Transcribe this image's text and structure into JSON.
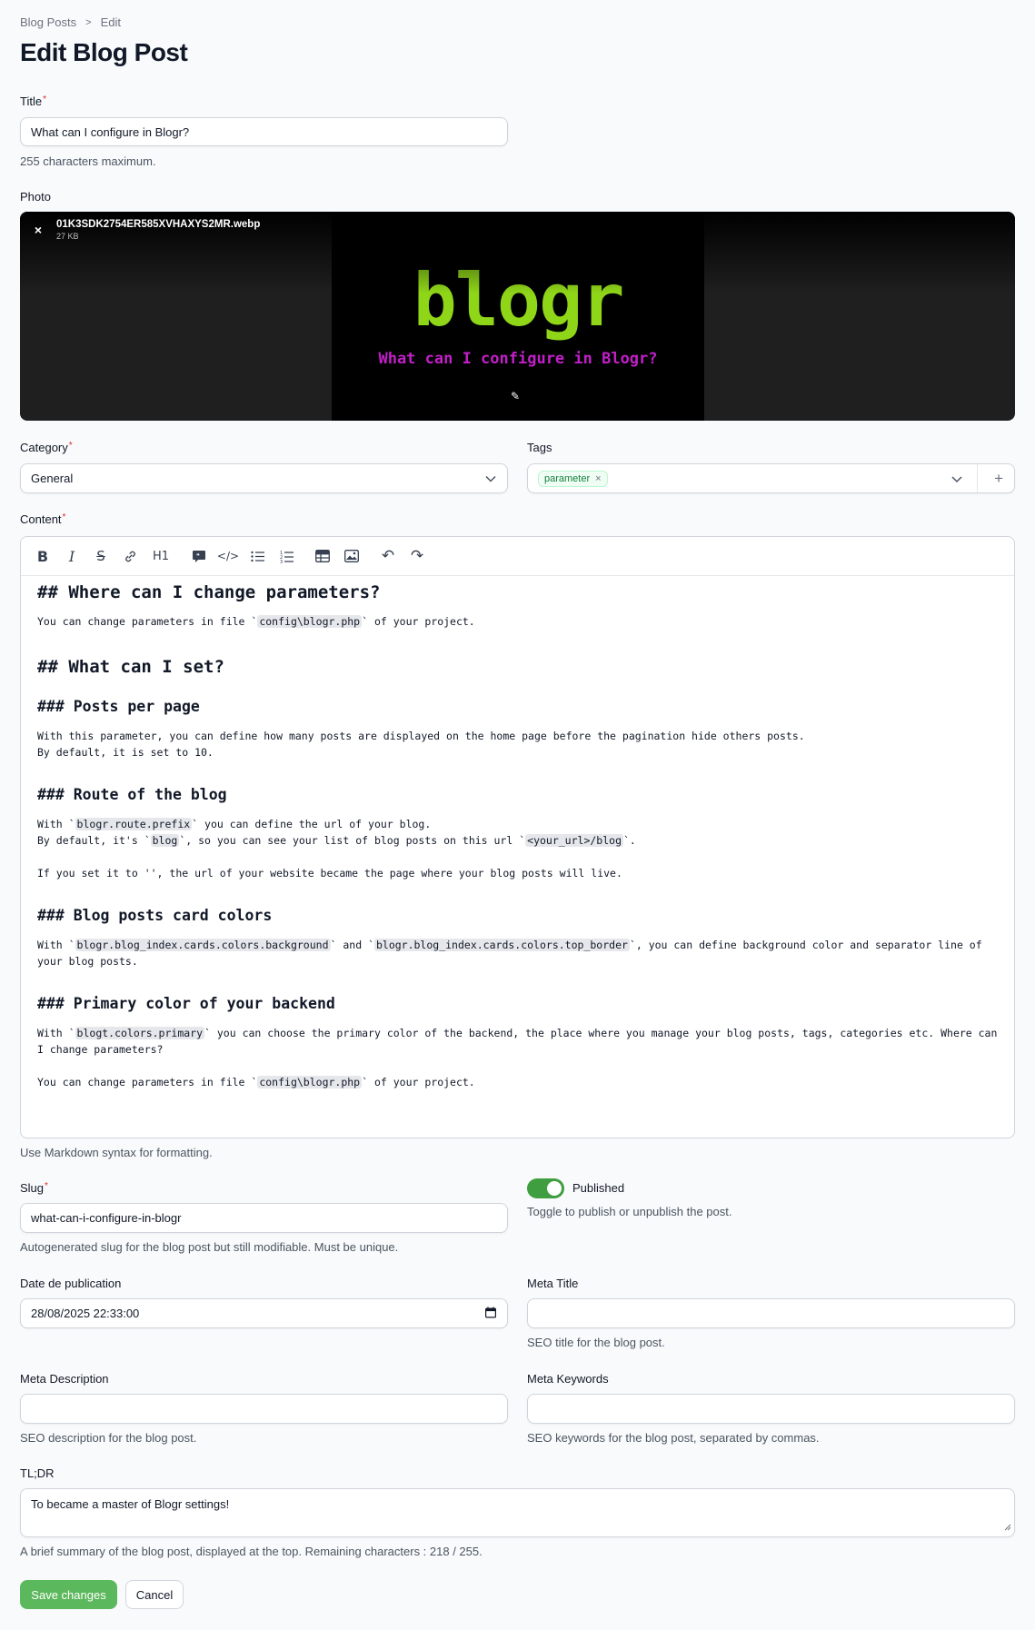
{
  "breadcrumb": {
    "parent": "Blog Posts",
    "separator": ">",
    "current": "Edit"
  },
  "page_title": "Edit Blog Post",
  "title_field": {
    "label": "Title",
    "value": "What can I configure in Blogr?",
    "hint": "255 characters maximum."
  },
  "photo": {
    "label": "Photo",
    "file_name": "01K3SDK2754ER585XVHAXYS2MR.webp",
    "file_size": "27 KB",
    "image_logo": "blogr",
    "image_caption": "What can I configure in Blogr?",
    "close_glyph": "×",
    "edit_glyph": "✎"
  },
  "category": {
    "label": "Category",
    "value": "General"
  },
  "tags": {
    "label": "Tags",
    "items": [
      "parameter"
    ],
    "remove_glyph": "×",
    "add_glyph": "+"
  },
  "content": {
    "label": "Content",
    "hint": "Use Markdown syntax for formatting.",
    "toolbar": {
      "bold": "B",
      "italic": "I",
      "strike": "S",
      "link": "🔗",
      "heading": "H1",
      "quote": "❝",
      "code": "</>",
      "bullet_list": "☰",
      "ordered_list": "≡",
      "table": "▦",
      "image": "▣",
      "undo": "↶",
      "redo": "↷"
    },
    "lines": {
      "h_change": "## Where can I change parameters?",
      "p_change_a": "You can change parameters in file `",
      "p_change_code": "config\\blogr.php",
      "p_change_b": "` of your project.",
      "h_set": "## What can I set?",
      "h_posts": "### Posts per page",
      "p_posts_1": "With this parameter, you can define how many posts are displayed on the home page before the pagination hide others posts.",
      "p_posts_2": "By default, it is set to 10.",
      "h_route": "### Route of the blog",
      "p_route_1a": "With `",
      "p_route_1code": "blogr.route.prefix",
      "p_route_1b": "` you can define the url of your blog.",
      "p_route_2a": "By default, it's `",
      "p_route_2code": "blog",
      "p_route_2b": "`, so you can see your list of blog posts on this url `",
      "p_route_2code2": "<your_url>/blog",
      "p_route_2c": "`.",
      "p_route_3": "If you set it to '', the url of your website became the page where your blog posts will live.",
      "h_colors": "### Blog posts card colors",
      "p_colors_1a": "With `",
      "p_colors_1code": "blogr.blog_index.cards.colors.background",
      "p_colors_1b": "` and `",
      "p_colors_1code2": "blogr.blog_index.cards.colors.top_border",
      "p_colors_1c": "`, you can define background color and separator line of",
      "p_colors_2": "your blog posts.",
      "h_primary": "### Primary color of your backend",
      "p_primary_1a": "With `",
      "p_primary_1code": "blogt.colors.primary",
      "p_primary_1b": "` you can choose the primary color of the backend, the place where you manage your blog posts, tags, categories etc. Where can",
      "p_primary_2": "I change parameters?",
      "p_final_a": "You can change parameters in file `",
      "p_final_code": "config\\blogr.php",
      "p_final_b": "` of your project."
    }
  },
  "slug": {
    "label": "Slug",
    "value": "what-can-i-configure-in-blogr",
    "hint": "Autogenerated slug for the blog post but still modifiable. Must be unique."
  },
  "published": {
    "label": "Published",
    "hint": "Toggle to publish or unpublish the post.",
    "on": true
  },
  "publication_date": {
    "label": "Date de publication",
    "value": "28/08/2025 22:33:00"
  },
  "meta_title": {
    "label": "Meta Title",
    "value": "",
    "hint": "SEO title for the blog post."
  },
  "meta_description": {
    "label": "Meta Description",
    "value": "",
    "hint": "SEO description for the blog post."
  },
  "meta_keywords": {
    "label": "Meta Keywords",
    "value": "",
    "hint": "SEO keywords for the blog post, separated by commas."
  },
  "tldr": {
    "label": "TL;DR",
    "value": "To became a master of Blogr settings!",
    "hint": "A brief summary of the blog post, displayed at the top. Remaining characters : 218 / 255."
  },
  "actions": {
    "save": "Save changes",
    "cancel": "Cancel"
  },
  "colors": {
    "primary": "#5cb85c",
    "toggle_on": "#3f9e3f",
    "logo_green": "#8fd619",
    "logo_magenta": "#c21fc9"
  }
}
